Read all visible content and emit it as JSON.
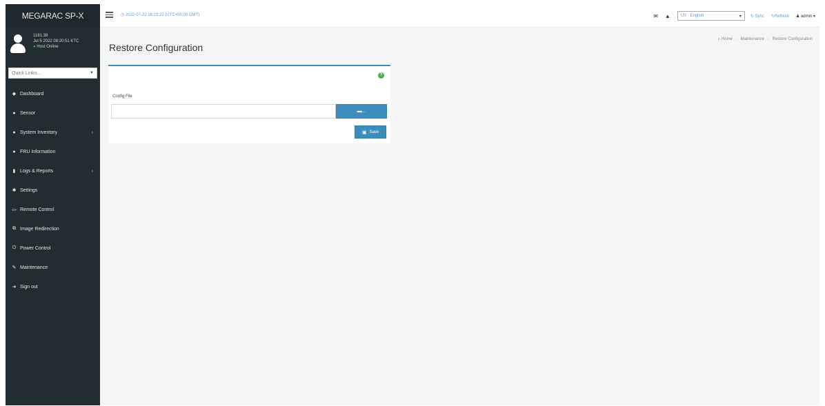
{
  "brand": "MEGARAC SP-X",
  "user": {
    "line1": "1181.39",
    "line2": "Jul 5 2022 08:20:51 KTC",
    "status": "Host Online"
  },
  "quicklinks": {
    "label": "Quick Links..."
  },
  "menu": [
    {
      "label": "Dashboard",
      "icon": "dashboard-icon",
      "glyph": "◆",
      "arrow": false
    },
    {
      "label": "Sensor",
      "icon": "sensor-icon",
      "glyph": "●",
      "arrow": false
    },
    {
      "label": "System Inventory",
      "icon": "inventory-icon",
      "glyph": "●",
      "arrow": true
    },
    {
      "label": "FRU Information",
      "icon": "fru-icon",
      "glyph": "●",
      "arrow": false
    },
    {
      "label": "Logs & Reports",
      "icon": "logs-icon",
      "glyph": "▮",
      "arrow": true
    },
    {
      "label": "Settings",
      "icon": "settings-icon",
      "glyph": "✱",
      "arrow": false
    },
    {
      "label": "Remote Control",
      "icon": "remote-control-icon",
      "glyph": "▭",
      "arrow": false
    },
    {
      "label": "Image Redirection",
      "icon": "image-redirection-icon",
      "glyph": "⧉",
      "arrow": false
    },
    {
      "label": "Power Control",
      "icon": "power-icon",
      "glyph": "⏻",
      "arrow": false
    },
    {
      "label": "Maintenance",
      "icon": "wrench-icon",
      "glyph": "✎",
      "arrow": false
    },
    {
      "label": "Sign out",
      "icon": "sign-out-icon",
      "glyph": "➜",
      "arrow": false
    }
  ],
  "topbar": {
    "datetime": "2022-07-22 16:23:22 (UTC+00:00 GMT)",
    "language": "US - English",
    "sync": "Sync",
    "refresh": "Refresh",
    "user": "admin"
  },
  "breadcrumb": {
    "home": "Home",
    "section": "Maintenance",
    "current": "Restore Configuration"
  },
  "page": {
    "title": "Restore Configuration",
    "config_label": "Config File",
    "browse_label": "...",
    "save_label": "Save"
  }
}
